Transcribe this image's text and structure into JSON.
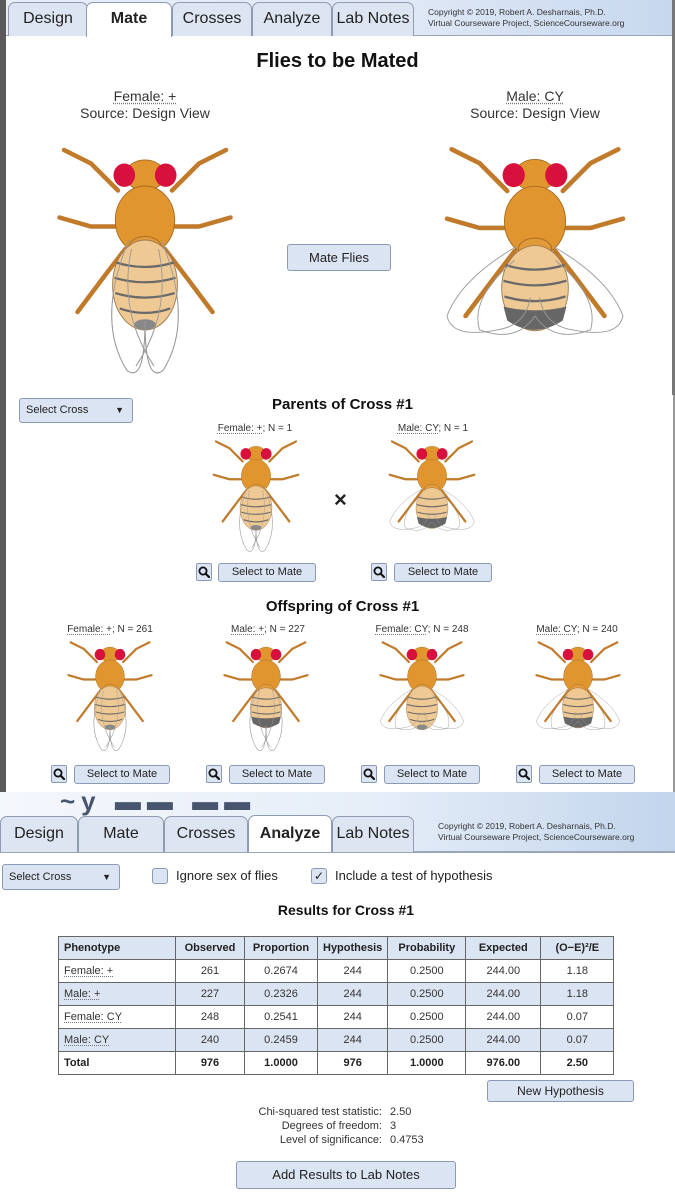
{
  "mate_view": {
    "tabs": [
      {
        "label": "Design",
        "active": false
      },
      {
        "label": "Mate",
        "active": true
      },
      {
        "label": "Crosses",
        "active": false
      },
      {
        "label": "Analyze",
        "active": false
      },
      {
        "label": "Lab Notes",
        "active": false
      }
    ],
    "copyright_line1": "Copyright © 2019, Robert A. Desharnais, Ph.D.",
    "copyright_line2": "Virtual Courseware Project, ScienceCourseware.org",
    "title": "Flies to be Mated",
    "female": {
      "label": "Female: +",
      "source": "Source: Design View"
    },
    "male": {
      "label": "Male: CY",
      "source": "Source: Design View"
    },
    "mate_button": "Mate Flies",
    "select_cross": {
      "label": "Select Cross",
      "arrow": "▼"
    },
    "parents": {
      "title": "Parents of Cross #1",
      "items": [
        {
          "phenotype": "Female: +",
          "count": "; N = 1",
          "select_label": "Select to Mate"
        },
        {
          "phenotype": "Male: CY",
          "count": "; N = 1",
          "select_label": "Select to Mate"
        }
      ],
      "cross_symbol": "×"
    },
    "offspring": {
      "title": "Offspring of Cross #1",
      "items": [
        {
          "phenotype": "Female: +",
          "count": "; N = 261",
          "select_label": "Select to Mate"
        },
        {
          "phenotype": "Male: +",
          "count": "; N = 227",
          "select_label": "Select to Mate"
        },
        {
          "phenotype": "Female: CY",
          "count": "; N = 248",
          "select_label": "Select to Mate"
        },
        {
          "phenotype": "Male: CY",
          "count": "; N = 240",
          "select_label": "Select to Mate"
        }
      ]
    }
  },
  "analyze_view": {
    "tabs": [
      {
        "label": "Design",
        "active": false
      },
      {
        "label": "Mate",
        "active": false
      },
      {
        "label": "Crosses",
        "active": false
      },
      {
        "label": "Analyze",
        "active": true
      },
      {
        "label": "Lab Notes",
        "active": false
      }
    ],
    "copyright_line1": "Copyright © 2019, Robert A. Desharnais, Ph.D.",
    "copyright_line2": "Virtual Courseware Project, ScienceCourseware.org",
    "select_cross": {
      "label": "Select Cross",
      "arrow": "▼"
    },
    "ignore_sex": {
      "label": "Ignore sex of flies",
      "checked": false
    },
    "include_test": {
      "label": "Include a test of hypothesis",
      "checked": true,
      "mark": "✓"
    },
    "results_title": "Results for Cross #1",
    "table": {
      "headers": [
        "Phenotype",
        "Observed",
        "Proportion",
        "Hypothesis",
        "Probability",
        "Expected",
        "(O−E)²/E"
      ],
      "rows": [
        [
          "Female: +",
          "261",
          "0.2674",
          "244",
          "0.2500",
          "244.00",
          "1.18"
        ],
        [
          "Male: +",
          "227",
          "0.2326",
          "244",
          "0.2500",
          "244.00",
          "1.18"
        ],
        [
          "Female: CY",
          "248",
          "0.2541",
          "244",
          "0.2500",
          "244.00",
          "0.07"
        ],
        [
          "Male: CY",
          "240",
          "0.2459",
          "244",
          "0.2500",
          "244.00",
          "0.07"
        ]
      ],
      "total": [
        "Total",
        "976",
        "1.0000",
        "976",
        "1.0000",
        "976.00",
        "2.50"
      ]
    },
    "new_hypothesis_button": "New Hypothesis",
    "stats": {
      "chi_label": "Chi-squared test statistic:",
      "chi_value": "2.50",
      "df_label": "Degrees of freedom:",
      "df_value": "3",
      "sig_label": "Level of significance:",
      "sig_value": "0.4753"
    },
    "add_results_button": "Add Results to Lab Notes"
  },
  "colors": {
    "button_bg": "#dbe4f2",
    "eye_red": "#d8103e",
    "body_orange": "#e0952f"
  }
}
